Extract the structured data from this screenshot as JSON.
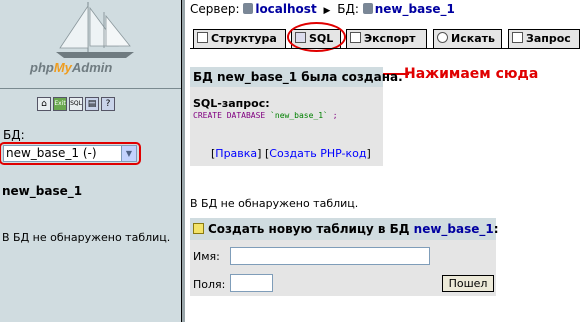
{
  "left": {
    "logo": {
      "prefix": "php",
      "accent": "My",
      "suffix": "Admin"
    },
    "icons": [
      "home-icon",
      "exit-icon",
      "sql-icon",
      "docs-icon",
      "help-icon"
    ],
    "db_label": "БД:",
    "db_select_value": "new_base_1 (-)",
    "db_name": "new_base_1",
    "no_tables": "В БД не обнаружено таблиц."
  },
  "header": {
    "server_label": "Сервер:",
    "server_value": "localhost",
    "db_label": "БД:",
    "db_value": "new_base_1"
  },
  "tabs": [
    {
      "label": "Структура",
      "icon": "structure-icon"
    },
    {
      "label": "SQL",
      "icon": "sql-icon"
    },
    {
      "label": "Экспорт",
      "icon": "export-icon"
    },
    {
      "label": "Искать",
      "icon": "search-icon"
    },
    {
      "label": "Запрос",
      "icon": "query-icon"
    }
  ],
  "annotation": "Нажимаем сюда",
  "message": {
    "title": "БД new_base_1 была создана.",
    "sql_label": "SQL-запрос:",
    "sql_code": "CREATE DATABASE",
    "sql_name": "`new_base_1`",
    "sql_end": " ;",
    "link_edit": "Правка",
    "link_php": "Создать PHP-код"
  },
  "right_no_tables": "В БД не обнаружено таблиц.",
  "create_table": {
    "title": "Создать новую таблицу в БД",
    "db": "new_base_1",
    "name_label": "Имя:",
    "fields_label": "Поля:",
    "go_label": "Пошел"
  },
  "colors": {
    "annotation": "#e00000",
    "sidebar_bg": "#D0DCE0",
    "box_bg": "#E5E5E5"
  }
}
